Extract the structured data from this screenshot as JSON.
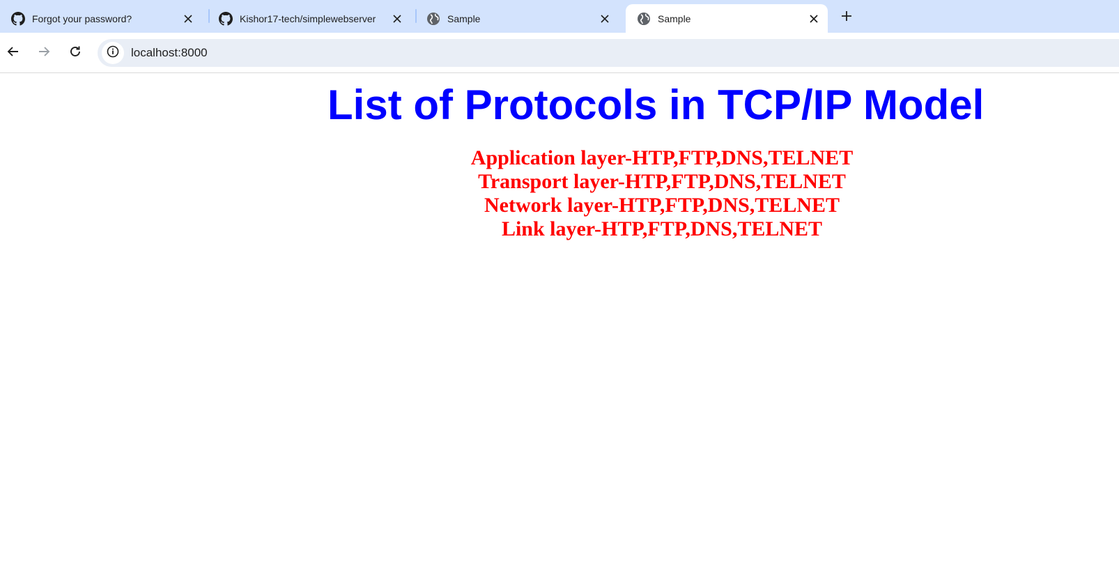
{
  "browser": {
    "tabs": [
      {
        "title": "Forgot your password?",
        "favicon": "github-icon",
        "active": false
      },
      {
        "title": "Kishor17-tech/simplewebserver",
        "favicon": "github-icon",
        "active": false
      },
      {
        "title": "Sample",
        "favicon": "globe-icon",
        "active": false
      },
      {
        "title": "Sample",
        "favicon": "globe-icon",
        "active": true
      }
    ],
    "new_tab_icon": "plus-icon",
    "nav": {
      "back_icon": "arrow-left-icon",
      "forward_icon": "arrow-right-icon",
      "reload_icon": "reload-icon"
    },
    "address": {
      "url": "localhost:8000",
      "site_info_icon": "info-icon"
    }
  },
  "page": {
    "heading": "List of Protocols in TCP/IP Model",
    "heading_color": "#0000ff",
    "protocol_color": "#ff0000",
    "protocols": [
      "Application layer-HTP,FTP,DNS,TELNET",
      "Transport layer-HTP,FTP,DNS,TELNET",
      "Network layer-HTP,FTP,DNS,TELNET",
      "Link layer-HTP,FTP,DNS,TELNET"
    ]
  }
}
